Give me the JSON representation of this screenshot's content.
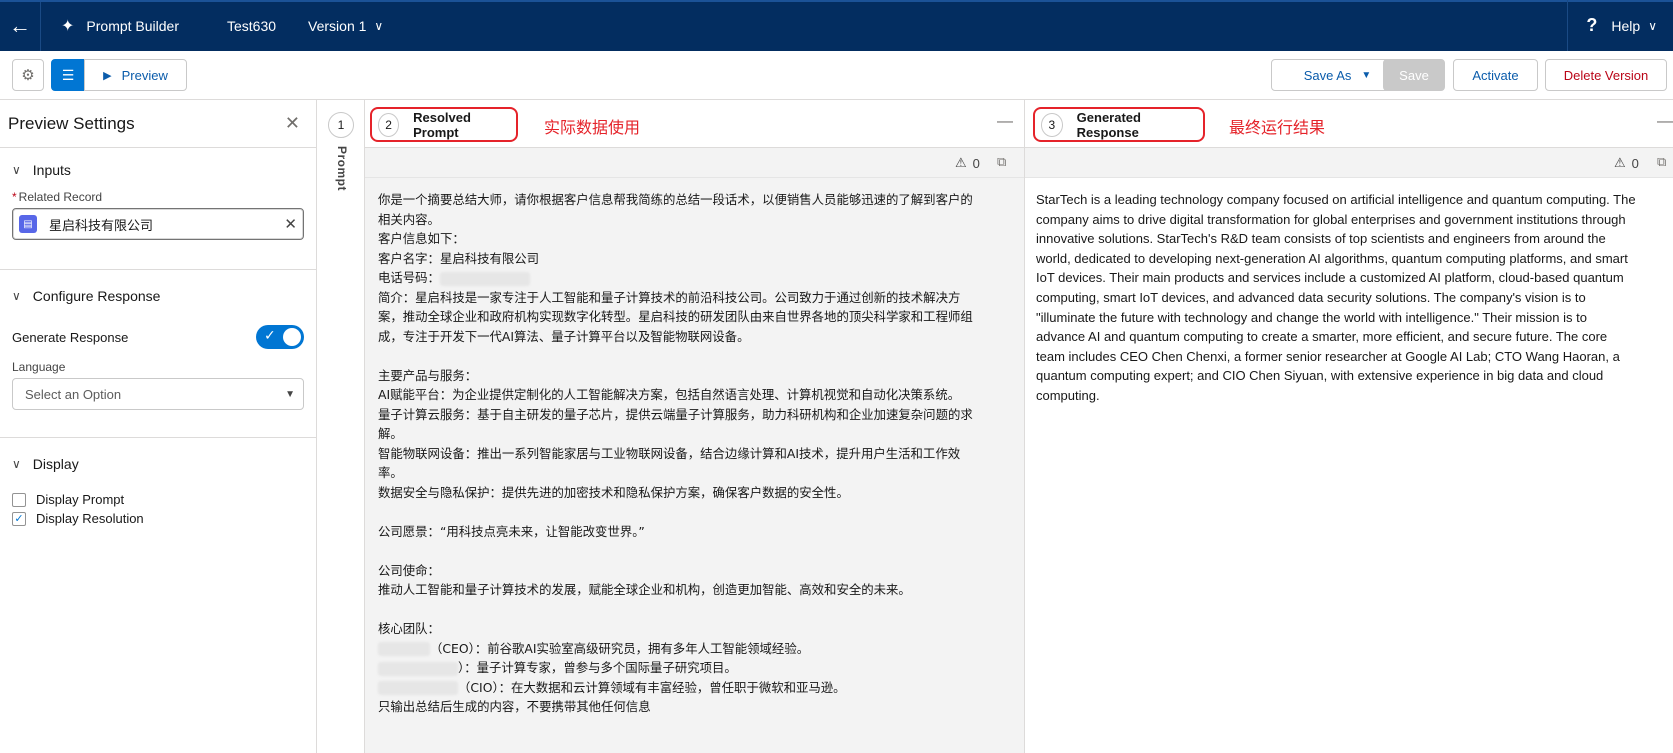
{
  "topbar": {
    "back_icon": "arrow-left-icon",
    "app_name": "Prompt Builder",
    "template_name": "Test630",
    "version_label": "Version 1",
    "help_label": "Help"
  },
  "toolbar": {
    "preview_label": "Preview",
    "save_as_label": "Save As",
    "save_label": "Save",
    "activate_label": "Activate",
    "delete_label": "Delete Version"
  },
  "settings": {
    "title": "Preview Settings",
    "inputs": {
      "heading": "Inputs",
      "related_record_label": "Related Record",
      "related_record_value": "星启科技有限公司"
    },
    "configure": {
      "heading": "Configure Response",
      "generate_label": "Generate Response",
      "generate_on": true,
      "language_label": "Language",
      "language_placeholder": "Select an Option"
    },
    "display": {
      "heading": "Display",
      "display_prompt_label": "Display Prompt",
      "display_prompt_checked": false,
      "display_resolution_label": "Display Resolution",
      "display_resolution_checked": true
    }
  },
  "rail": {
    "number": "1",
    "label": "Prompt"
  },
  "resolved": {
    "number": "2",
    "title": "Resolved Prompt",
    "annotation": "实际数据使用",
    "warning_count": "0",
    "lines": [
      "你是一个摘要总结大师，请你根据客户信息帮我简练的总结一段话术，以便销售人员能够迅速的了解到客户的",
      "相关内容。",
      "客户信息如下：",
      "客户名字：星启科技有限公司",
      "电话号码：",
      "简介：星启科技是一家专注于人工智能和量子计算技术的前沿科技公司。公司致力于通过创新的技术解决方",
      "案，推动全球企业和政府机构实现数字化转型。星启科技的研发团队由来自世界各地的顶尖科学家和工程师组",
      "成，专注于开发下一代AI算法、量子计算平台以及智能物联网设备。",
      "",
      "主要产品与服务：",
      "AI赋能平台：为企业提供定制化的人工智能解决方案，包括自然语言处理、计算机视觉和自动化决策系统。",
      "量子计算云服务：基于自主研发的量子芯片，提供云端量子计算服务，助力科研机构和企业加速复杂问题的求",
      "解。",
      "智能物联网设备：推出一系列智能家居与工业物联网设备，结合边缘计算和AI技术，提升用户生活和工作效",
      "率。",
      "数据安全与隐私保护：提供先进的加密技术和隐私保护方案，确保客户数据的安全性。",
      "",
      "公司愿景：“用科技点亮未来，让智能改变世界。”",
      "",
      "公司使命：",
      "推动人工智能和量子计算技术的发展，赋能全球企业和机构，创造更加智能、高效和安全的未来。",
      "",
      "核心团队：",
      "（CEO）：前谷歌AI实验室高级研究员，拥有多年人工智能领域经验。",
      "）：量子计算专家，曾参与多个国际量子研究项目。",
      "（CIO）：在大数据和云计算领域有丰富经验，曾任职于微软和亚马逊。",
      "只输出总结后生成的内容，不要携带其他任何信息"
    ]
  },
  "generated": {
    "number": "3",
    "title": "Generated Response",
    "annotation": "最终运行结果",
    "warning_count": "0",
    "lines": [
      "StarTech is a leading technology company focused on artificial intelligence and quantum computing. The",
      "company aims to drive digital transformation for global enterprises and government institutions through",
      "innovative solutions. StarTech's R&D team consists of top scientists and engineers from around the",
      "world, dedicated to developing next-generation AI algorithms, quantum computing platforms, and smart",
      "IoT devices. Their main products and services include a customized AI platform, cloud-based quantum",
      "computing, smart IoT devices, and advanced data security solutions. The company's vision is to",
      "\"illuminate the future with technology and change the world with intelligence.\" Their mission is to",
      "advance AI and quantum computing to create a smarter, more efficient, and secure future. The core",
      "team includes CEO Chen Chenxi, a former senior researcher at Google AI Lab; CTO Wang Haoran, a",
      "quantum computing expert; and CIO Chen Siyuan, with extensive experience in big data and cloud",
      "computing."
    ]
  },
  "colors": {
    "header_bg": "#032d60",
    "brand": "#0176d3",
    "annotation_red": "#e5232a"
  }
}
